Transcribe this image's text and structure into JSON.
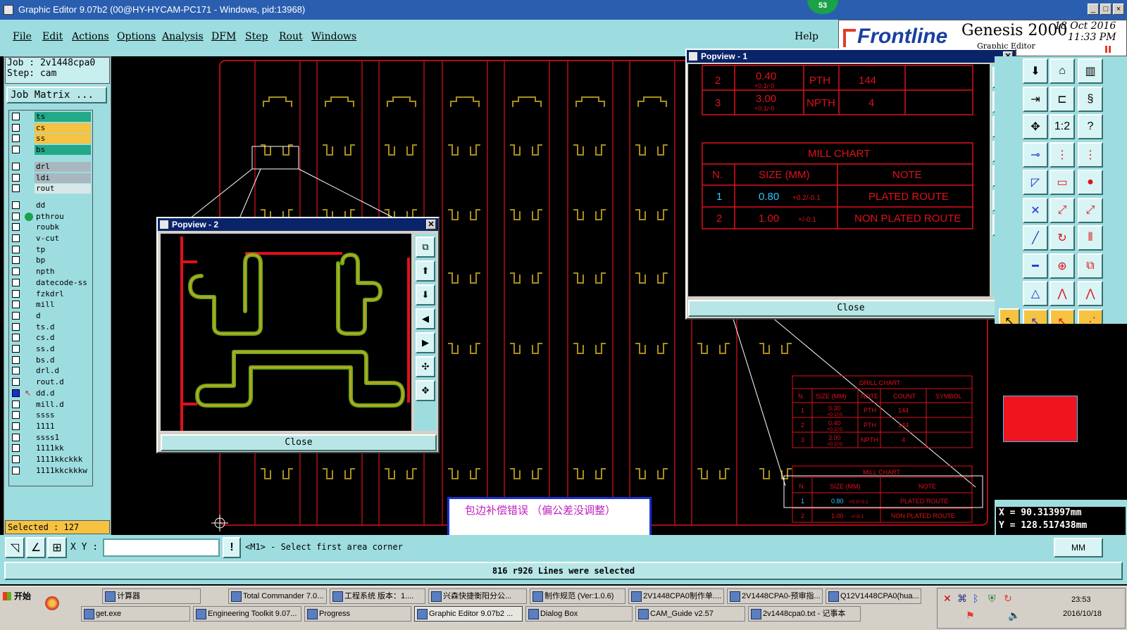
{
  "window": {
    "title": "Graphic Editor 9.07b2 (00@HY-HYCAM-PC171 - Windows, pid:13968)",
    "badge": "53",
    "controls": [
      "_",
      "□",
      "×"
    ]
  },
  "menu": [
    "File",
    "Edit",
    "Actions",
    "Options",
    "Analysis",
    "DFM",
    "Step",
    "Rout",
    "Windows"
  ],
  "help": "Help",
  "brand": {
    "logo": "Frontline",
    "product": "Genesis 2000",
    "subtitle": "Graphic Editor",
    "date": "18 Oct 2016",
    "time": "11:33 PM"
  },
  "job": {
    "job": "Job : 2v1448cpa0",
    "step": "Step: cam",
    "matrix_button": "Job Matrix ..."
  },
  "layers": [
    {
      "name": "ts",
      "color": "#23a888"
    },
    {
      "name": "cs",
      "color": "#f5c242"
    },
    {
      "name": "ss",
      "color": "#f5c242"
    },
    {
      "name": "bs",
      "color": "#23a888"
    },
    {
      "name": "drl",
      "color": "#a9b8c0"
    },
    {
      "name": "ldi",
      "color": "#a9b8c0"
    },
    {
      "name": "rout",
      "color": "#d8e8e8"
    },
    {
      "name": "dd",
      "color": "#9ddde0"
    },
    {
      "name": "pthrou",
      "color": "#9ddde0"
    },
    {
      "name": "roubk",
      "color": "#9ddde0"
    },
    {
      "name": "v-cut",
      "color": "#9ddde0"
    },
    {
      "name": "tp",
      "color": "#9ddde0"
    },
    {
      "name": "bp",
      "color": "#9ddde0"
    },
    {
      "name": "npth",
      "color": "#9ddde0"
    },
    {
      "name": "datecode-ss",
      "color": "#9ddde0"
    },
    {
      "name": "fzkdrl",
      "color": "#9ddde0"
    },
    {
      "name": "mill",
      "color": "#9ddde0"
    },
    {
      "name": "d",
      "color": "#9ddde0"
    },
    {
      "name": "ts.d",
      "color": "#9ddde0"
    },
    {
      "name": "cs.d",
      "color": "#9ddde0"
    },
    {
      "name": "ss.d",
      "color": "#9ddde0"
    },
    {
      "name": "bs.d",
      "color": "#9ddde0"
    },
    {
      "name": "drl.d",
      "color": "#9ddde0"
    },
    {
      "name": "rout.d",
      "color": "#9ddde0"
    },
    {
      "name": "dd.d",
      "color": "#9ddde0"
    },
    {
      "name": "mill.d",
      "color": "#9ddde0"
    },
    {
      "name": "ssss",
      "color": "#9ddde0"
    },
    {
      "name": "1111",
      "color": "#9ddde0"
    },
    {
      "name": "ssss1",
      "color": "#9ddde0"
    },
    {
      "name": "1111kk",
      "color": "#9ddde0"
    },
    {
      "name": "1111kkckkk",
      "color": "#9ddde0"
    },
    {
      "name": "1111kkckkkw",
      "color": "#9ddde0"
    }
  ],
  "selected": "Selected : 127",
  "popview1": {
    "title": "Popview - 1",
    "close": "Close",
    "drill_rows": [
      [
        "2",
        "0.40",
        "+0.1/-0",
        "PTH",
        "144"
      ],
      [
        "3",
        "3.00",
        "+0.1/-0",
        "NPTH",
        "4"
      ]
    ],
    "mill_title": "MILL CHART",
    "mill_header": [
      "N.",
      "SIZE (MM)",
      "NOTE"
    ],
    "mill_rows": [
      [
        "1",
        "0.80",
        "+0.2/-0.1",
        "PLATED ROUTE"
      ],
      [
        "2",
        "1.00",
        "+/-0.1",
        "NON PLATED ROUTE"
      ]
    ]
  },
  "popview2": {
    "title": "Popview - 2",
    "close": "Close"
  },
  "canvas_chart": {
    "drill_title": "DRILL CHART",
    "drill_header": [
      "N.",
      "SIZE (MM)",
      "NOTE",
      "COUNT",
      "SYMBOL"
    ],
    "drill_rows": [
      [
        "1",
        "0.30",
        "+0.1/-0",
        "PTH",
        "144"
      ],
      [
        "2",
        "0.40",
        "+0.1/-0",
        "PTH",
        "144"
      ],
      [
        "3",
        "3.00",
        "+0.1/-0",
        "NPTH",
        "4"
      ]
    ],
    "mill_title": "MILL CHART",
    "mill_header": [
      "N.",
      "SIZE (MM)",
      "NOTE"
    ],
    "mill_rows": [
      [
        "1",
        "0.80",
        "+0.2/-0.1",
        "PLATED ROUTE"
      ],
      [
        "2",
        "1.00",
        "+/-0.1",
        "NON PLATED ROUTE"
      ]
    ]
  },
  "note": "包边补偿错误  （偏公差没调整）",
  "coords": {
    "x": "X = 90.313997mm",
    "y": "Y = 128.517438mm"
  },
  "status": {
    "xy_label": "X Y :",
    "prompt": "<M1> - Select first area corner",
    "units": "MM",
    "message": "816 r926 Lines were selected"
  },
  "taskbar": {
    "start": "开始",
    "row1": [
      "计算器",
      "Total Commander 7.0...",
      "工程系统  版本：1....",
      "兴森快捷衡阳分公...",
      "制作规范 (Ver:1.0.6)",
      "2V1448CPA0制作单....",
      "2V1448CPA0-预审指...",
      "Q12V1448CPA0(hua..."
    ],
    "row2": [
      "get.exe",
      "Engineering Toolkit 9.07...",
      "Progress",
      "Graphic Editor 9.07b2 ...",
      "Dialog Box",
      "CAM_Guide v2.57",
      "2v1448cpa0.txt - 记事本"
    ],
    "clock_time": "23:53",
    "clock_date": "2016/10/18"
  }
}
